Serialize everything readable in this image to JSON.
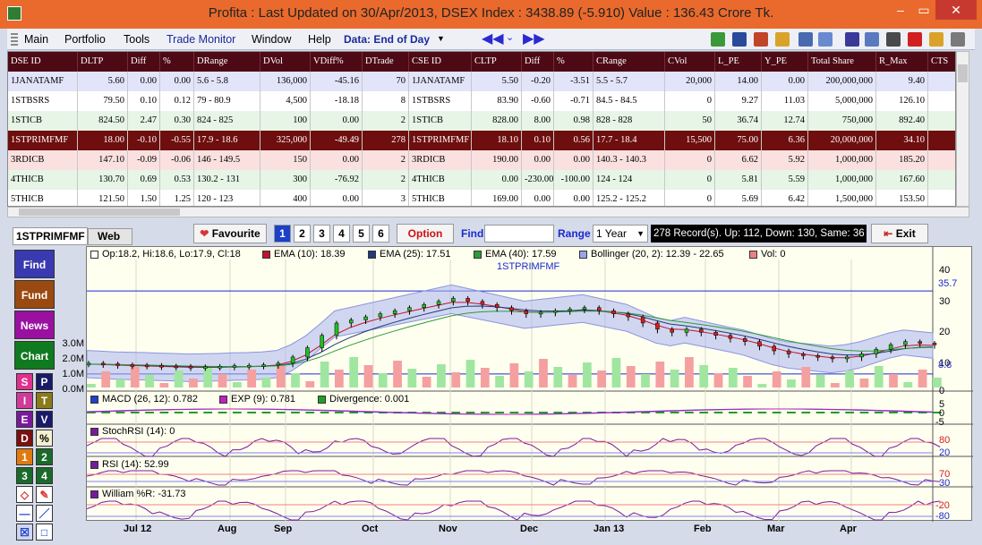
{
  "window": {
    "title": "Profita : Last Updated on 30/Apr/2013,  DSEX Index : 3438.89 (-5.910)  Value : 136.43 Crore Tk.",
    "min": "–",
    "restore": "▭",
    "close": "✕"
  },
  "menu": {
    "items": [
      "Main",
      "Portfolio",
      "Tools",
      "Trade Monitor",
      "Window",
      "Help"
    ],
    "data_selector": "Data: End of Day"
  },
  "table": {
    "columns": [
      "DSE ID",
      "DLTP",
      "Diff",
      "%",
      "DRange",
      "DVol",
      "VDiff%",
      "DTrade",
      "CSE ID",
      "CLTP",
      "Diff",
      "%",
      "CRange",
      "CVol",
      "L_PE",
      "Y_PE",
      "Total Share",
      "R_Max",
      "CTS"
    ],
    "rows": [
      [
        "1JANATAMF",
        "5.60",
        "0.00",
        "0.00",
        "5.6 -  5.8",
        "136,000",
        "-45.16",
        "70",
        "1JANATAMF",
        "5.50",
        "-0.20",
        "-3.51",
        "5.5 -  5.7",
        "20,000",
        "14.00",
        "0.00",
        "200,000,000",
        "9.40",
        ""
      ],
      [
        "1STBSRS",
        "79.50",
        "0.10",
        "0.12",
        "79 -  80.9",
        "4,500",
        "-18.18",
        "8",
        "1STBSRS",
        "83.90",
        "-0.60",
        "-0.71",
        "84.5 -  84.5",
        "0",
        "9.27",
        "11.03",
        "5,000,000",
        "126.10",
        ""
      ],
      [
        "1STICB",
        "824.50",
        "2.47",
        "0.30",
        "824 -  825",
        "100",
        "0.00",
        "2",
        "1STICB",
        "828.00",
        "8.00",
        "0.98",
        "828 -  828",
        "50",
        "36.74",
        "12.74",
        "750,000",
        "892.40",
        ""
      ],
      [
        "1STPRIMFMF",
        "18.00",
        "-0.10",
        "-0.55",
        "17.9 -  18.6",
        "325,000",
        "-49.49",
        "278",
        "1STPRIMFMF",
        "18.10",
        "0.10",
        "0.56",
        "17.7 -  18.4",
        "15,500",
        "75.00",
        "6.36",
        "20,000,000",
        "34.10",
        ""
      ],
      [
        "3RDICB",
        "147.10",
        "-0.09",
        "-0.06",
        "146 -  149.5",
        "150",
        "0.00",
        "2",
        "3RDICB",
        "190.00",
        "0.00",
        "0.00",
        "140.3 -  140.3",
        "0",
        "6.62",
        "5.92",
        "1,000,000",
        "185.20",
        ""
      ],
      [
        "4THICB",
        "130.70",
        "0.69",
        "0.53",
        "130.2 -  131",
        "300",
        "-76.92",
        "2",
        "4THICB",
        "0.00",
        "-230.00",
        "-100.00",
        "124 -  124",
        "0",
        "5.81",
        "5.59",
        "1,000,000",
        "167.60",
        ""
      ],
      [
        "5THICB",
        "121.50",
        "1.50",
        "1.25",
        "120 -  123",
        "400",
        "0.00",
        "3",
        "5THICB",
        "169.00",
        "0.00",
        "0.00",
        "125.2 -  125.2",
        "0",
        "5.69",
        "6.42",
        "1,500,000",
        "153.50",
        ""
      ]
    ]
  },
  "controls": {
    "symbol_tab": "1STPRIMFMF",
    "web_tab": "Web",
    "favourite": "Favourite",
    "layouts": [
      "1",
      "2",
      "3",
      "4",
      "5",
      "6"
    ],
    "option": "Option",
    "find_label": "Find",
    "find_value": "",
    "range_label": "Range",
    "range_value": "1 Year",
    "status": "278 Record(s). Up: 112, Down: 130, Same: 36",
    "exit": "Exit"
  },
  "left_panel": {
    "buttons": [
      "Find",
      "Fund",
      "News",
      "Chart"
    ],
    "grid": [
      "S",
      "P",
      "I",
      "T",
      "E",
      "V",
      "D",
      "%",
      "1",
      "2",
      "3",
      "4"
    ]
  },
  "chart_data": {
    "type": "line",
    "title": "1STPRIMFMF",
    "ohlc_label": "Op:18.2, Hi:18.6, Lo:17.9, Cl:18",
    "legends": [
      {
        "name": "EMA (10): 18.39",
        "color": "#c0142c"
      },
      {
        "name": "EMA (25): 17.51",
        "color": "#1f3b7a"
      },
      {
        "name": "EMA (40): 17.59",
        "color": "#2e9a3a"
      },
      {
        "name": "Bollinger (20, 2): 12.39 - 22.65",
        "color": "#9aa4e8"
      },
      {
        "name": "Vol: 0",
        "color": "#f08080"
      }
    ],
    "price_axis": [
      "40",
      "30",
      "20",
      "10"
    ],
    "marker_high": "35.7",
    "marker_low": "8.8",
    "vol_axis": [
      "3.0M",
      "2.0M",
      "1.0M",
      "0.0M"
    ],
    "x_labels": [
      "Jul 12",
      "Aug",
      "Sep",
      "Oct",
      "Nov",
      "Dec",
      "Jan 13",
      "Feb",
      "Mar",
      "Apr"
    ],
    "close": [
      12,
      11.8,
      11.5,
      11.4,
      11.3,
      11.1,
      11,
      10.8,
      10.9,
      11,
      11.2,
      11.3,
      11.5,
      12,
      14,
      17,
      21,
      25,
      26,
      27,
      28,
      29,
      30,
      31,
      32,
      33,
      32,
      31,
      30,
      29,
      28,
      28.5,
      29,
      29.5,
      30,
      29,
      28,
      27,
      25,
      23,
      22,
      23,
      22,
      21,
      20,
      19,
      17.5,
      16,
      15,
      14.5,
      14,
      13.5,
      14,
      15,
      16.5,
      18,
      19,
      18.5,
      18
    ],
    "macd": {
      "label": "MACD (26, 12): 0.782",
      "exp": "EXP (9): 0.781",
      "divergence": "Divergence: 0.001",
      "axis": [
        "5",
        "0",
        "-5"
      ]
    },
    "stochrsi": {
      "label": "StochRSI (14): 0",
      "axis": [
        "80",
        "20"
      ]
    },
    "rsi": {
      "label": "RSI (14): 52.99",
      "axis": [
        "70",
        "30"
      ]
    },
    "williams": {
      "label": "William %R: -31.73",
      "axis": [
        "-20",
        "-80"
      ]
    }
  },
  "colors": {
    "title_bg": "#e96a2c",
    "header_bg": "#4d0a14",
    "selected_row": "#6e0e0e"
  }
}
